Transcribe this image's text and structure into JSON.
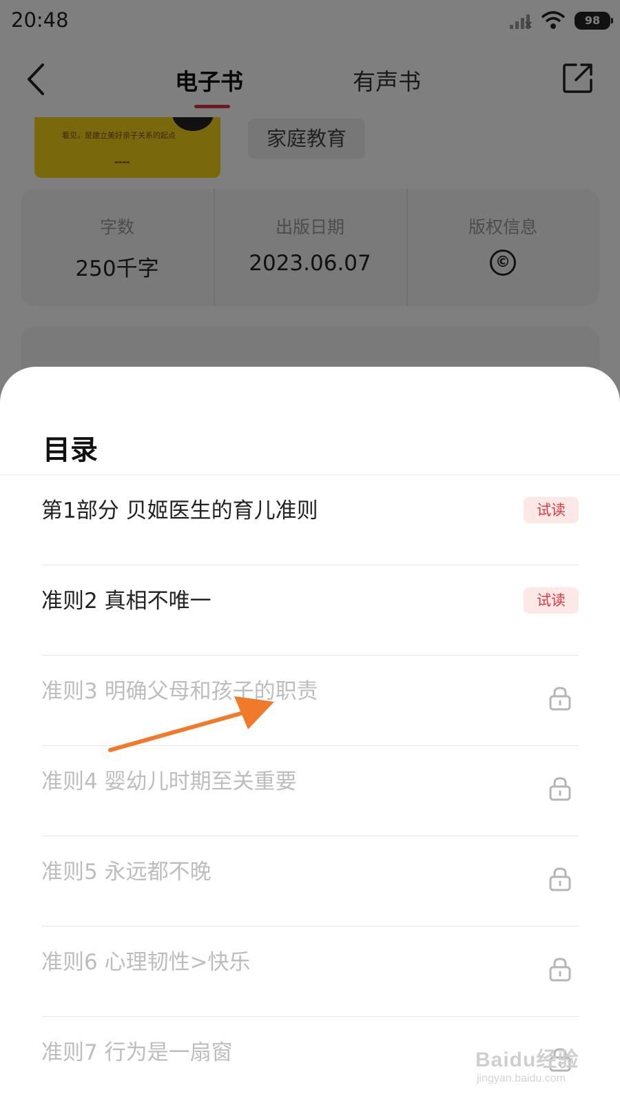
{
  "status_bar": {
    "time": "20:48",
    "battery": "98",
    "icons": [
      "signal-icon",
      "wifi-icon",
      "battery-icon"
    ]
  },
  "nav": {
    "tabs": [
      {
        "label": "电子书",
        "active": true
      },
      {
        "label": "有声书",
        "active": false
      }
    ],
    "icons": [
      "back-icon",
      "share-icon"
    ],
    "accent_color": "#d8343a"
  },
  "book": {
    "category_tag": "家庭教育",
    "cover_caption": "看见，是建立美好亲子关系的起点",
    "info": [
      {
        "label": "字数",
        "value": "250千字"
      },
      {
        "label": "出版日期",
        "value": "2023.06.07"
      },
      {
        "label": "版权信息",
        "value": "©"
      }
    ]
  },
  "toc_sheet": {
    "title": "目录",
    "trial_color": "#e0393d",
    "items": [
      {
        "title": "第1部分 贝姬医生的育儿准则",
        "badge": "试读",
        "locked": false
      },
      {
        "title": "准则2 真相不唯一",
        "badge": "试读",
        "locked": false
      },
      {
        "title": "准则3 明确父母和孩子的职责",
        "badge": null,
        "locked": true
      },
      {
        "title": "准则4 婴幼儿时期至关重要",
        "badge": null,
        "locked": true
      },
      {
        "title": "准则5 永远都不晚",
        "badge": null,
        "locked": true
      },
      {
        "title": "准则6 心理韧性>快乐",
        "badge": null,
        "locked": true
      },
      {
        "title": "准则7 行为是一扇窗",
        "badge": null,
        "locked": true
      }
    ]
  },
  "watermark": {
    "brand": "Baidu经验",
    "url": "jingyan.baidu.com"
  }
}
